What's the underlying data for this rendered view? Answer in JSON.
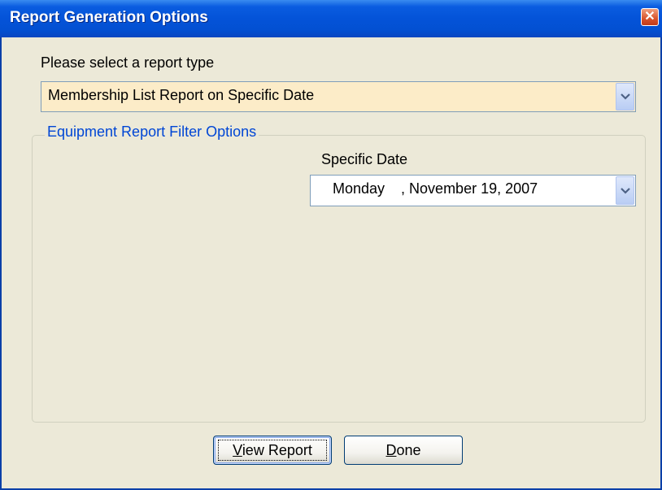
{
  "window": {
    "title": "Report Generation Options",
    "close_glyph": "✕"
  },
  "report_type": {
    "label": "Please select a report type",
    "selected": "Membership List Report on Specific Date",
    "background": "#fcecc8"
  },
  "filter_group": {
    "title": "Equipment Report Filter Options",
    "specific_date": {
      "label": "Specific Date",
      "value": "Monday    , November 19, 2007"
    }
  },
  "buttons": {
    "view_report": {
      "mnemonic": "V",
      "rest": "iew Report"
    },
    "done": {
      "mnemonic": "D",
      "rest": "one"
    }
  },
  "colors": {
    "title_bar": "#0453d8",
    "dialog_bg": "#ece9d8",
    "group_title": "#0046d5",
    "close_button": "#d8532b"
  }
}
